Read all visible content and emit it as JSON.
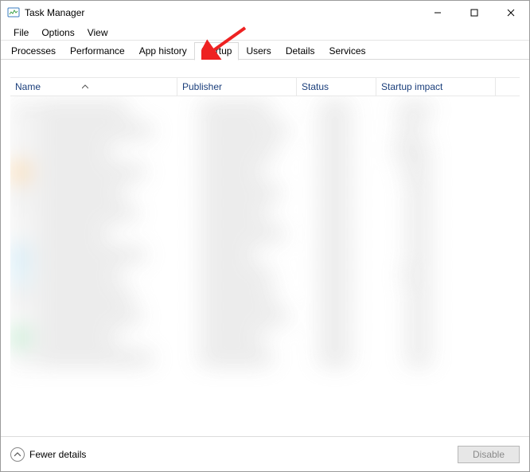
{
  "window": {
    "title": "Task Manager"
  },
  "menu": {
    "file": "File",
    "options": "Options",
    "view": "View"
  },
  "tabs": {
    "processes": "Processes",
    "performance": "Performance",
    "app_history": "App history",
    "startup": "Startup",
    "users": "Users",
    "details": "Details",
    "services": "Services",
    "active": "startup"
  },
  "columns": {
    "name": "Name",
    "publisher": "Publisher",
    "status": "Status",
    "impact": "Startup impact"
  },
  "footer": {
    "fewer_details": "Fewer details",
    "disable": "Disable"
  }
}
